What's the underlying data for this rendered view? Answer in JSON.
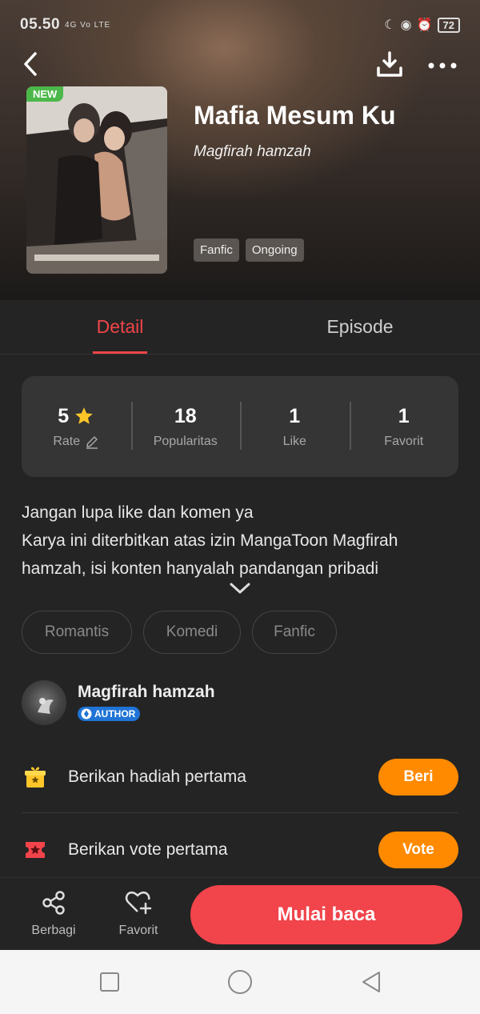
{
  "status_bar": {
    "time": "05.50",
    "network": "4G Vo LTE",
    "battery": "72"
  },
  "book": {
    "badge": "NEW",
    "title": "Mafia Mesum Ku",
    "author": "Magfirah hamzah",
    "tags": [
      "Fanfic",
      "Ongoing"
    ]
  },
  "tabs": {
    "detail": "Detail",
    "episode": "Episode",
    "active": "detail"
  },
  "stats": {
    "rate_value": "5",
    "rate_label": "Rate",
    "popularity_value": "18",
    "popularity_label": "Popularitas",
    "like_value": "1",
    "like_label": "Like",
    "favorite_value": "1",
    "favorite_label": "Favorit"
  },
  "description": {
    "line1": "Jangan lupa like dan komen ya",
    "line2": "Karya ini diterbitkan atas izin MangaToon Magfirah hamzah, isi konten hanyalah pandangan pribadi"
  },
  "genres": [
    "Romantis",
    "Komedi",
    "Fanfic"
  ],
  "author": {
    "name": "Magfirah hamzah",
    "badge": "AUTHOR"
  },
  "actions": {
    "gift_text": "Berikan hadiah pertama",
    "gift_button": "Beri",
    "vote_text": "Berikan vote pertama",
    "vote_button": "Vote"
  },
  "bottom_bar": {
    "share_label": "Berbagi",
    "favorite_label": "Favorit",
    "start_label": "Mulai baca"
  },
  "colors": {
    "accent": "#f1444b",
    "orange": "#ff8a00",
    "background": "#242424"
  }
}
